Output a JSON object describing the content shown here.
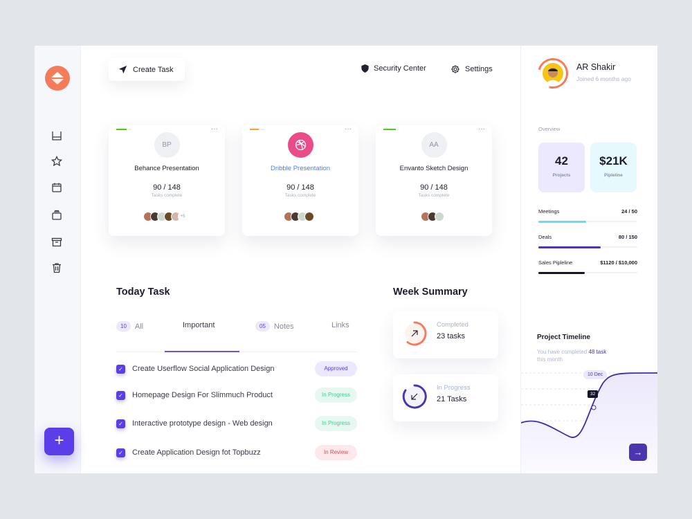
{
  "toolbar": {
    "create_task": "Create Task",
    "security": "Security Center",
    "settings": "Settings"
  },
  "sidebar": {
    "items": [
      "inbox-icon",
      "star-icon",
      "calendar-icon",
      "stack-icon",
      "archive-icon",
      "trash-icon"
    ],
    "add_label": "+"
  },
  "projects": [
    {
      "initials": "BP",
      "name": "Behance Presentation",
      "count": "90 / 148",
      "sub": "Tasks complete",
      "progress": 0.7,
      "color": "#55c81e",
      "more": "+5",
      "avatars": [
        "#b5735a",
        "#4a3a34",
        "#cfd8cf",
        "#6b4a2a",
        "#d4b5a8"
      ],
      "name_color": "#1d1d2b"
    },
    {
      "initials": "",
      "name": "Dribble Presentation",
      "count": "90 / 148",
      "sub": "Tasks complete",
      "progress": 0.6,
      "color": "#f5a623",
      "more": "",
      "avatars": [
        "#b5735a",
        "#4a3a34",
        "#cfd8cf",
        "#6b4a2a"
      ],
      "name_color": "#4a7ef5",
      "icon_bg": "#ea4c89"
    },
    {
      "initials": "AA",
      "name": "Envanto Sketch Design",
      "count": "90 / 148",
      "sub": "Tasks complete",
      "progress": 0.8,
      "color": "#55c81e",
      "more": "",
      "avatars": [
        "#b5735a",
        "#4a3a34",
        "#cfd8cf"
      ],
      "name_color": "#1d1d2b"
    }
  ],
  "today": {
    "title": "Today Task",
    "tabs": [
      {
        "count": "10",
        "label": "All"
      },
      {
        "label": "Important"
      },
      {
        "count": "05",
        "label": "Notes"
      },
      {
        "label": "Links"
      }
    ],
    "tasks": [
      {
        "label": "Create Userflow Social Application Design",
        "status": "Approved"
      },
      {
        "label": "Homepage Design For Slimmuch Product",
        "status": "In Progress"
      },
      {
        "label": "Interactive prototype design - Web design",
        "status": "In Progress"
      },
      {
        "label": "Create Application Design fot Topbuzz",
        "status": "In Review"
      }
    ]
  },
  "week": {
    "title": "Week Summary",
    "completed": {
      "label": "Completed",
      "value": "23 tasks"
    },
    "progress": {
      "label": "In Progress",
      "value": "21 Tasks"
    }
  },
  "profile": {
    "name": "AR Shakir",
    "joined": "Joined 6 months ago"
  },
  "overview": {
    "title": "Overview",
    "projects": {
      "value": "42",
      "label": "Projects"
    },
    "pipeline": {
      "value": "$21K",
      "label": "Pipleline"
    },
    "bars": [
      {
        "label": "Meetings",
        "value": "24 / 50",
        "fraction": 0.48,
        "color": "#5ee0ee"
      },
      {
        "label": "Deals",
        "value": "80 / 150",
        "fraction": 0.63,
        "color": "#4b36b0"
      },
      {
        "label": "Sales Pipleline",
        "value": "$1120 / $10,000",
        "fraction": 0.47,
        "color": "#14142a"
      }
    ]
  },
  "timeline": {
    "title": "Project Timeline",
    "sub_pre": "You have completed ",
    "sub_strong": "48 task",
    "sub_post": "this month",
    "date": "10 Dec",
    "point": "32"
  }
}
